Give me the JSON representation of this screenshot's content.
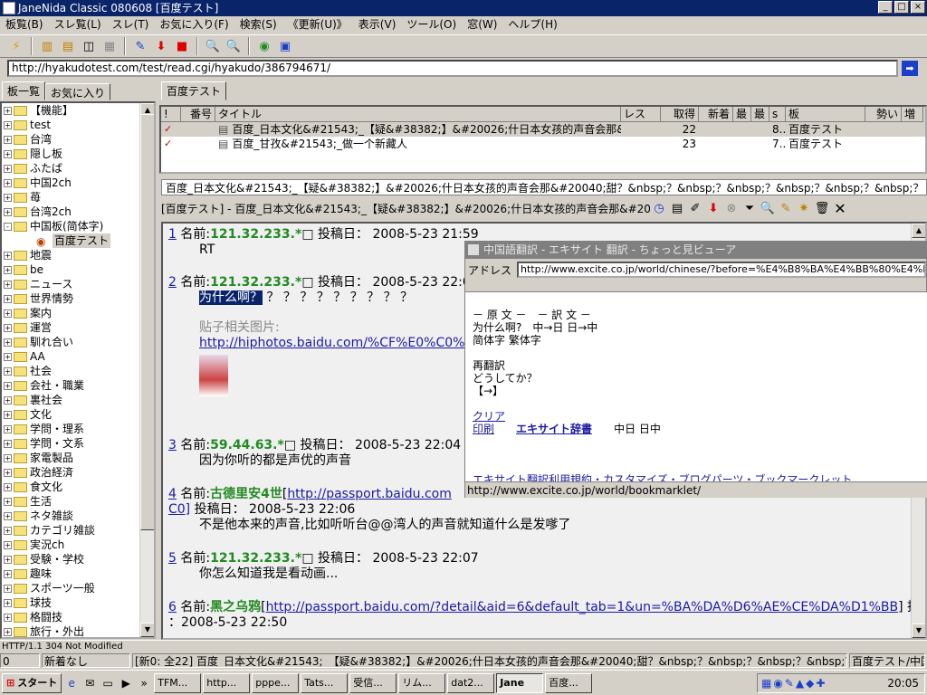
{
  "window": {
    "title": "JaneNida Classic 080608 [百度テスト]"
  },
  "menu": [
    "板覧(B)",
    "スレ覧(L)",
    "スレ(T)",
    "お気に入り(F)",
    "検索(S)",
    "《更新(U)》",
    "表示(V)",
    "ツール(O)",
    "窓(W)",
    "ヘルプ(H)"
  ],
  "address": {
    "url": "http://hyakudotest.com/test/read.cgi/hyakudo/386794671/"
  },
  "left_tabs": [
    "板一覧",
    "お気に入り"
  ],
  "tree": [
    {
      "label": "【機能】",
      "depth": 0,
      "sign": "+"
    },
    {
      "label": "test",
      "depth": 0,
      "sign": "+"
    },
    {
      "label": "台湾",
      "depth": 0,
      "sign": "+"
    },
    {
      "label": "隠し板",
      "depth": 0,
      "sign": "+"
    },
    {
      "label": "ふたば",
      "depth": 0,
      "sign": "+"
    },
    {
      "label": "中国2ch",
      "depth": 0,
      "sign": "+"
    },
    {
      "label": "苺",
      "depth": 0,
      "sign": "+"
    },
    {
      "label": "台湾2ch",
      "depth": 0,
      "sign": "+"
    },
    {
      "label": "中国板(简体字)",
      "depth": 0,
      "sign": "-"
    },
    {
      "label": "百度テスト",
      "depth": 1,
      "sign": ""
    },
    {
      "label": "地震",
      "depth": 0,
      "sign": "+"
    },
    {
      "label": "be",
      "depth": 0,
      "sign": "+"
    },
    {
      "label": "ニュース",
      "depth": 0,
      "sign": "+"
    },
    {
      "label": "世界情勢",
      "depth": 0,
      "sign": "+"
    },
    {
      "label": "案内",
      "depth": 0,
      "sign": "+"
    },
    {
      "label": "運営",
      "depth": 0,
      "sign": "+"
    },
    {
      "label": "馴れ合い",
      "depth": 0,
      "sign": "+"
    },
    {
      "label": "AA",
      "depth": 0,
      "sign": "+"
    },
    {
      "label": "社会",
      "depth": 0,
      "sign": "+"
    },
    {
      "label": "会社・職業",
      "depth": 0,
      "sign": "+"
    },
    {
      "label": "裏社会",
      "depth": 0,
      "sign": "+"
    },
    {
      "label": "文化",
      "depth": 0,
      "sign": "+"
    },
    {
      "label": "学問・理系",
      "depth": 0,
      "sign": "+"
    },
    {
      "label": "学問・文系",
      "depth": 0,
      "sign": "+"
    },
    {
      "label": "家電製品",
      "depth": 0,
      "sign": "+"
    },
    {
      "label": "政治経済",
      "depth": 0,
      "sign": "+"
    },
    {
      "label": "食文化",
      "depth": 0,
      "sign": "+"
    },
    {
      "label": "生活",
      "depth": 0,
      "sign": "+"
    },
    {
      "label": "ネタ雑談",
      "depth": 0,
      "sign": "+"
    },
    {
      "label": "カテゴリ雑談",
      "depth": 0,
      "sign": "+"
    },
    {
      "label": "実況ch",
      "depth": 0,
      "sign": "+"
    },
    {
      "label": "受験・学校",
      "depth": 0,
      "sign": "+"
    },
    {
      "label": "趣味",
      "depth": 0,
      "sign": "+"
    },
    {
      "label": "スポーツ一般",
      "depth": 0,
      "sign": "+"
    },
    {
      "label": "球技",
      "depth": 0,
      "sign": "+"
    },
    {
      "label": "格闘技",
      "depth": 0,
      "sign": "+"
    },
    {
      "label": "旅行・外出",
      "depth": 0,
      "sign": "+"
    }
  ],
  "board_tab": "百度テスト",
  "grid": {
    "headers": [
      "!",
      "番号",
      "タイトル",
      "レス",
      "取得",
      "新着",
      "最",
      "最",
      "s",
      "板",
      "勢い",
      "増"
    ],
    "rows": [
      {
        "title": "百度_日本文化&#21543;_【疑&#38382;】&#20026;什日本女孩的声音会那&#20040;...",
        "get": "22",
        "s": "8...",
        "board": "百度テスト"
      },
      {
        "title": "百度_甘孜&#21543;_做一个新藏人",
        "get": "23",
        "s": "7...",
        "board": "百度テスト"
      }
    ]
  },
  "thread_title": "百度_日本文化&#21543;_【疑&#38382;】&#20026;什日本女孩的声音会那&#20040;甜？&nbsp;？&nbsp;？&nbsp;？&nbsp;？&nbsp;？&nbsp;？",
  "thread_bar": "[百度テスト] - 百度_日本文化&#21543;_【疑&#38382;】&#20026;什日本女孩的声音会那&#20040;甜？&nbsp",
  "posts": {
    "p1": {
      "num": "1",
      "label": "名前:",
      "name": "121.32.233.*",
      "date": "投稿日： 2008-5-23 21:59",
      "body": "RT"
    },
    "p2": {
      "num": "2",
      "label": "名前:",
      "name": "121.32.233.*",
      "date": "投稿日： 2008-5-23 22:0",
      "sel": "为什么啊？",
      "rest": "？ ？ ？ ？ ？ ？ ？ ？ ？",
      "img_label": "贴子相关图片:",
      "img_link": "http://hiphotos.baidu.com/%CF%E0%C0%C7%"
    },
    "p3": {
      "num": "3",
      "label": "名前:",
      "name": "59.44.63.*",
      "date": "投稿日： 2008-5-23 22:04",
      "body": "因为你听的都是声优的声音"
    },
    "p4": {
      "num": "4",
      "label": "名前:",
      "name": "古德里安4世",
      "link": "http://passport.baidu.com",
      "link2": "C0]",
      "date": "投稿日： 2008-5-23 22:06",
      "body": "不是他本来的声音,比如听听台@@湾人的声音就知道什么是发嗲了"
    },
    "p5": {
      "num": "5",
      "label": "名前:",
      "name": "121.32.233.*",
      "date": "投稿日： 2008-5-23 22:07",
      "body": "你怎么知道我是看动画..."
    },
    "p6": {
      "num": "6",
      "label": "名前:",
      "name": "黑之乌鸦",
      "link": "http://passport.baidu.com/?detail&aid=6&default_tab=1&un=%BA%DA%D6%AE%CE%DA%D1%BB",
      "date_a": "] 投稿日",
      "date": "：2008-5-23 22:50"
    }
  },
  "popup": {
    "title": "中国語翻訳 - エキサイト 翻訳 - ちょっと見ビューア",
    "addr_label": "アドレス",
    "addr": "http://www.excite.co.jp/world/chinese/?before=%E4%B8%BA%E4%BB%80%E4%B9%88%E5%95%8A",
    "l1": "－ 原 文 －　－ 訳 文 －",
    "l2": "为什么啊?　中→日 日→中",
    "l3": "简体字 繁体字",
    "l4": "再翻訳",
    "l5": "どうしてか？",
    "l6": "【→】",
    "clear": "クリア",
    "print": "印刷",
    "dict": "エキサイト辞書",
    "dict_mode": "中日 日中",
    "footer_links": "エキサイト翻訳利用規約・カスタマイズ・ブログパーツ・ブックマークレット",
    "status": "http://www.excite.co.jp/world/bookmarklet/"
  },
  "status": {
    "http": "HTTP/1.1 304 Not Modified",
    "c0": "0",
    "c1": "新着なし",
    "c2": "[新0: 全22] 百度_日本文化&#21543;_【疑&#38382;】&#20026;什日本女孩的声音会那&#20040;甜？&nbsp;？&nbsp;？&nbsp;？&nbsp;？&nbsp;？&nbsp;？",
    "c3": "百度テスト/中国"
  },
  "taskbar": {
    "start": "スタート",
    "tasks": [
      "TFM...",
      "http...",
      "pppe...",
      "Tats...",
      "受信...",
      "リム...",
      "dat2...",
      "Jane",
      "百度..."
    ],
    "clock": "20:05"
  }
}
